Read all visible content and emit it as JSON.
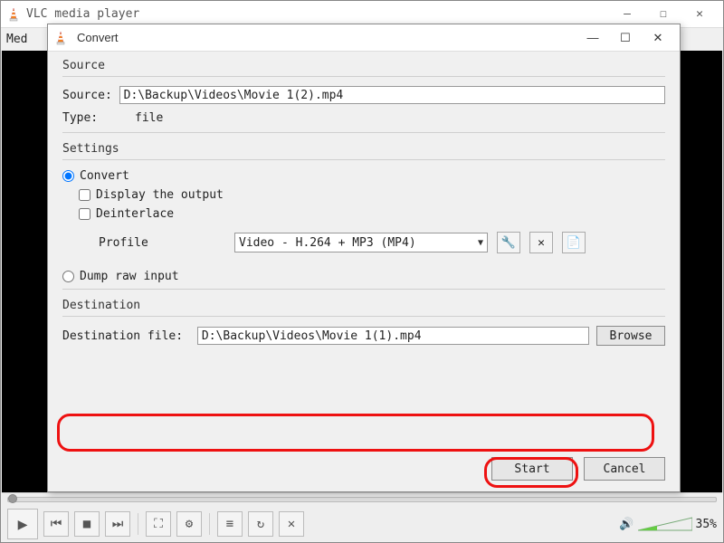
{
  "main": {
    "title": "VLC media player",
    "menu_first": "Med",
    "volume_pct": "35%"
  },
  "dialog": {
    "title": "Convert",
    "source": {
      "group": "Source",
      "source_label": "Source: ",
      "source_value": "D:\\Backup\\Videos\\Movie 1(2).mp4",
      "type_label": "Type:",
      "type_value": "file"
    },
    "settings": {
      "group": "Settings",
      "convert": "Convert",
      "display_output": "Display the output",
      "deinterlace": "Deinterlace",
      "profile_label": "Profile",
      "profile_value": "Video - H.264 + MP3 (MP4)",
      "dump_raw": "Dump raw input"
    },
    "destination": {
      "group": "Destination",
      "file_label": "Destination file: ",
      "file_value": "D:\\Backup\\Videos\\Movie 1(1).mp4",
      "browse": "Browse"
    },
    "start": "Start",
    "cancel": "Cancel"
  }
}
